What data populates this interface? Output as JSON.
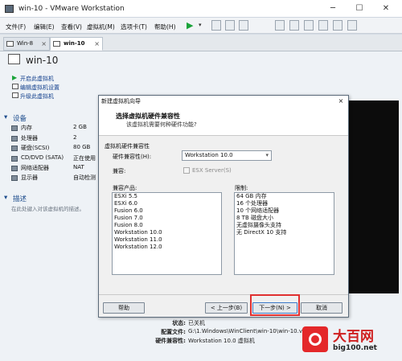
{
  "window": {
    "title": "win-10 - VMware Workstation",
    "minimize": "─",
    "maximize": "☐",
    "close": "✕"
  },
  "menu": {
    "items": [
      "文件(F)",
      "编辑(E)",
      "查看(V)",
      "虚拟机(M)",
      "选项卡(T)",
      "帮助(H)"
    ]
  },
  "tabs": [
    {
      "label": "Win-8",
      "close": "×"
    },
    {
      "label": "win-10",
      "close": "×"
    }
  ],
  "vm": {
    "name": "win-10",
    "actions": [
      "开启此虚拟机",
      "编辑虚拟机设置",
      "升级此虚拟机"
    ],
    "devices_title": "设备",
    "devices": [
      {
        "name": "内存",
        "value": "2 GB"
      },
      {
        "name": "处理器",
        "value": "2"
      },
      {
        "name": "硬盘(SCSI)",
        "value": "80 GB"
      },
      {
        "name": "CD/DVD (SATA)",
        "value": "正在使用"
      },
      {
        "name": "网络适配器",
        "value": "NAT"
      },
      {
        "name": "显示器",
        "value": "自动检测"
      }
    ],
    "desc_title": "描述",
    "desc_text": "在此处键入对该虚拟机的描述。"
  },
  "details": {
    "state_label": "状态:",
    "state_value": "已关机",
    "config_label": "配置文件:",
    "config_value": "G:\\1.Windows\\WinClient\\win-10\\win-10.v",
    "compat_label": "硬件兼容性:",
    "compat_value": "Workstation 10.0 虚拟机"
  },
  "dialog": {
    "title": "新建虚拟机向导",
    "close": "×",
    "heading": "选择虚拟机硬件兼容性",
    "subheading": "该虚拟机需要何种硬件功能?",
    "group_label": "虚拟机硬件兼容性",
    "compat_label": "硬件兼容性(H):",
    "compat_value": "Workstation 10.0",
    "compatible_label": "兼容:",
    "esx_label": "ESX Server(S)",
    "products_label": "兼容产品:",
    "products": [
      "ESXi 5.5",
      "ESXi 6.0",
      "Fusion 6.0",
      "Fusion 7.0",
      "Fusion 8.0",
      "Workstation 10.0",
      "Workstation 11.0",
      "Workstation 12.0"
    ],
    "limits_label": "限制:",
    "limits": [
      "64 GB 内存",
      "16 个处理器",
      "10 个网络适配器",
      "8 TB 磁盘大小",
      "无虚拟摄像头支持",
      "无 DirectX 10 支持"
    ],
    "help": "帮助",
    "back": "< 上一步(B)",
    "next": "下一步(N) >",
    "cancel": "取消"
  },
  "watermark": {
    "brand": "大百网",
    "url": "big100.net"
  }
}
